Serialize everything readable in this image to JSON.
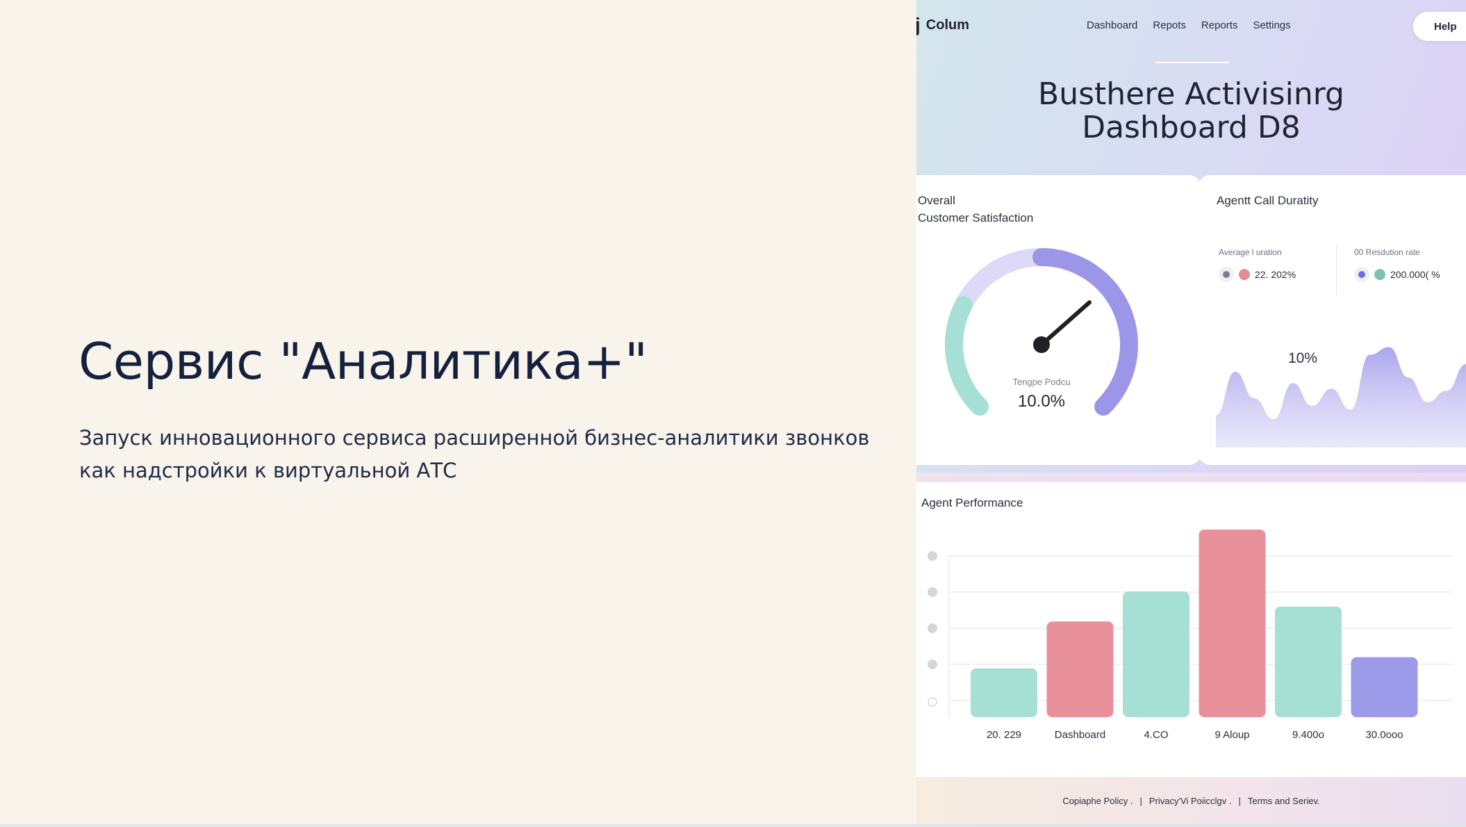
{
  "slide": {
    "title": "Сервис \"Аналитика+\"",
    "subtitle": "Запуск инновационного сервиса расширенной бизнес-аналитики звонков как надстройки к виртуальной АТС"
  },
  "dashboard": {
    "brand": {
      "icon": "j",
      "name": "Colum"
    },
    "nav": [
      "Dashboard",
      "Repots",
      "Reports",
      "Settings"
    ],
    "help_label": "Help",
    "title": "Busthere Activisinrg Dashboard D8",
    "satisfaction": {
      "title_line1": "Overall",
      "title_line2": "Customer Satisfaction",
      "gauge_caption": "Tengpe Podcu",
      "gauge_value": "10.0%",
      "gauge_fraction": 0.68,
      "colors": {
        "track": "#dcdaf6",
        "teal": "#a6dfd4",
        "purple": "#9c96e8",
        "needle": "#1f1f24"
      }
    },
    "duration": {
      "title": "Agentt Call Duratity",
      "avg_label": "Average l uration",
      "avg_value": "22. 202%",
      "res_label": "00 Resdution rate",
      "res_value": "200.000( %",
      "area_label": "10%",
      "area_values": [
        34,
        80,
        52,
        30,
        68,
        44,
        62,
        40,
        98,
        106,
        74,
        48,
        60,
        88
      ],
      "area_color": "#9c96e8"
    },
    "performance": {
      "title": "Agent Performance",
      "legend_icons": [
        "dot-icon",
        "dot-icon",
        "dot-icon",
        "dot-icon",
        "clock-icon"
      ],
      "colors": {
        "teal": "#a6dfd4",
        "pink": "#e8919a",
        "purple": "#9d9aea",
        "grid": "#ececf2",
        "dot": "#d4d6dc"
      }
    },
    "footer": {
      "links": [
        "Copiaphe Policy .",
        "Privacy'Vi Poiicclgv .",
        "Terms and Seriev."
      ],
      "separator": "|"
    }
  },
  "chart_data": {
    "type": "bar",
    "categories": [
      "20. 229",
      "Dashboard",
      "4.CO",
      "9 Aloup",
      "9.400o",
      "30.0ooo"
    ],
    "values": [
      26,
      51,
      67,
      100,
      59,
      32
    ],
    "ylim": [
      0,
      100
    ],
    "colors": [
      "#a6dfd4",
      "#e8919a",
      "#a6dfd4",
      "#e8919a",
      "#a6dfd4",
      "#9d9aea"
    ],
    "grid": true
  }
}
